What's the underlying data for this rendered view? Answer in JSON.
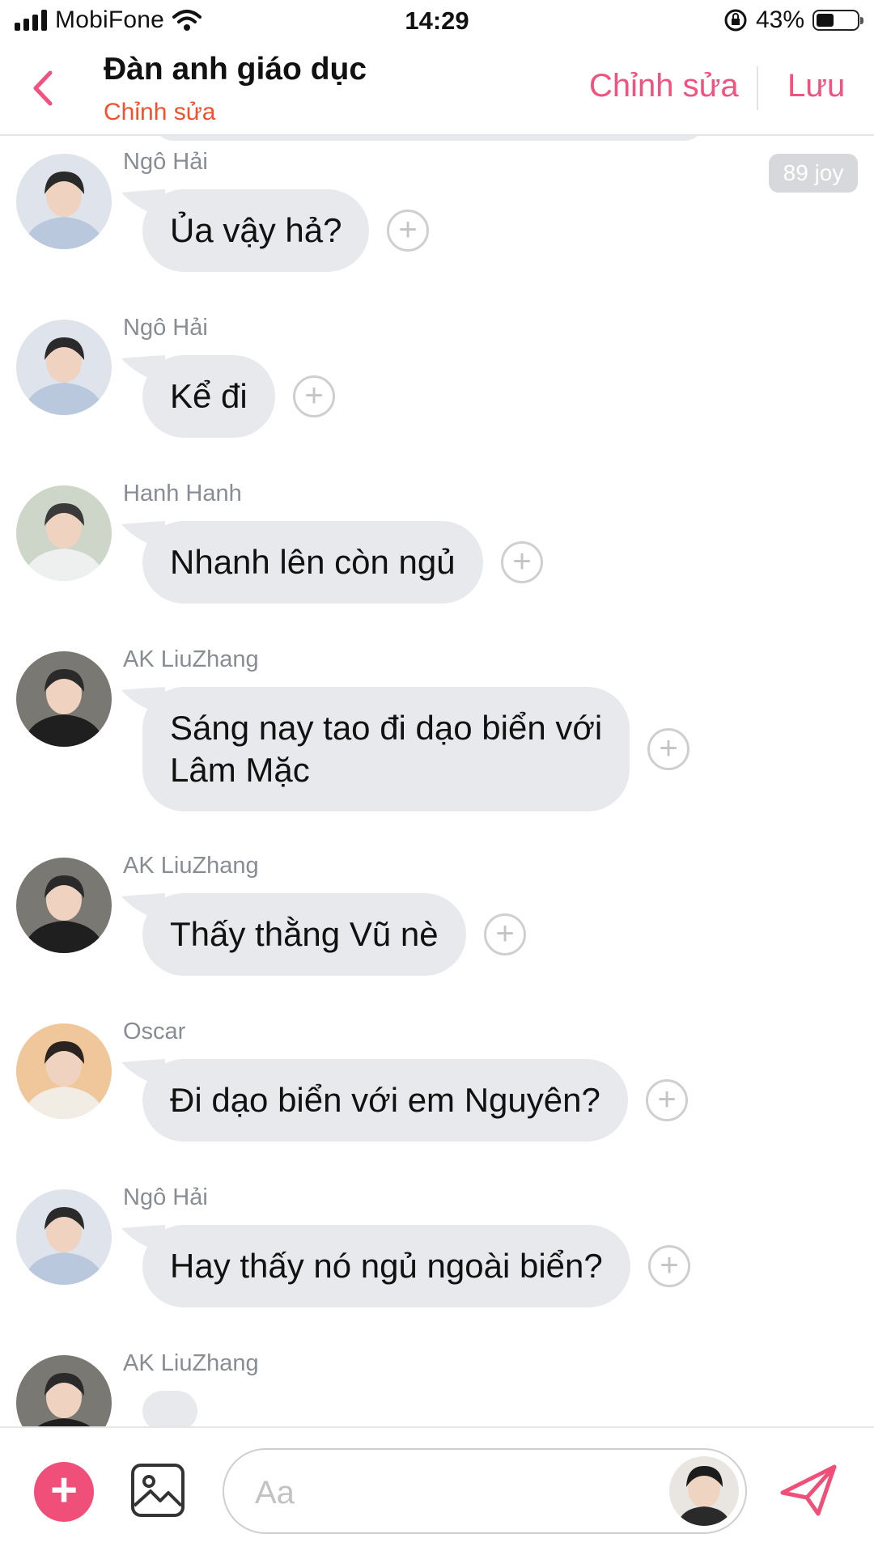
{
  "status_bar": {
    "carrier": "MobiFone",
    "time": "14:29",
    "battery_pct": "43%",
    "battery_level": 0.43
  },
  "header": {
    "title": "Đàn anh giáo dục",
    "subtitle": "Chỉnh sửa",
    "edit_label": "Chỉnh sửa",
    "save_label": "Lưu"
  },
  "badge": "89 joy",
  "messages": [
    {
      "sender": "Ngô Hải",
      "lines": [
        "Ủa vậy hả?"
      ]
    },
    {
      "sender": "Ngô Hải",
      "lines": [
        "Kể đi"
      ]
    },
    {
      "sender": "Hanh Hanh",
      "lines": [
        "Nhanh lên còn ngủ"
      ]
    },
    {
      "sender": "AK LiuZhang",
      "lines": [
        "Sáng nay tao đi dạo biển với",
        "Lâm Mặc"
      ]
    },
    {
      "sender": "AK LiuZhang",
      "lines": [
        "Thấy thằng Vũ nè"
      ]
    },
    {
      "sender": "Oscar",
      "lines": [
        "Đi dạo biển với em Nguyên?"
      ]
    },
    {
      "sender": "Ngô Hải",
      "lines": [
        "Hay thấy nó ngủ ngoài biển?"
      ]
    },
    {
      "sender": "AK LiuZhang",
      "lines": []
    }
  ],
  "composer": {
    "placeholder": "Aa",
    "value": ""
  },
  "icons": {
    "back": "chevron-left-icon",
    "add": "plus-icon",
    "image": "image-icon",
    "send": "send-icon",
    "react": "plus-circle-icon"
  },
  "colors": {
    "accent": "#f2527f",
    "subtitle": "#f0522e",
    "bubble": "#e8e9ec",
    "add_button": "#ef4f78"
  }
}
